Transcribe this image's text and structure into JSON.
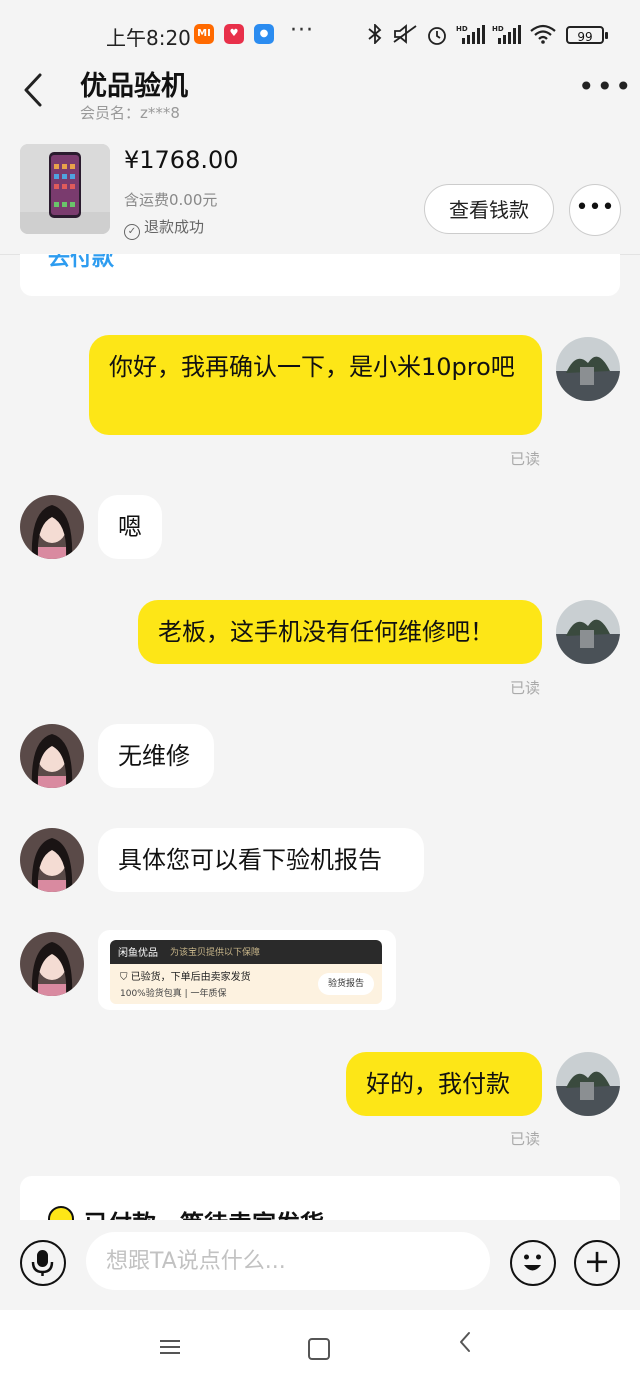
{
  "status_bar": {
    "time": "上午8:20",
    "battery": "99",
    "overflow": "···",
    "apps": [
      "mi-app-icon",
      "heart-app-icon",
      "chat-app-icon"
    ],
    "icons": [
      "bluetooth-icon",
      "mute-icon",
      "alarm-icon",
      "signal-hd-icon",
      "signal-hd-icon",
      "wifi-icon"
    ]
  },
  "header": {
    "title": "优品验机",
    "member_label": "会员名：z***8"
  },
  "product": {
    "price": "¥1768.00",
    "shipping": "含运费0.00元",
    "refund_status": "退款成功",
    "view_payment_button": "查看钱款"
  },
  "top_card": {
    "text": "去付款"
  },
  "messages": [
    {
      "side": "me",
      "text": "你好，我再确认一下，是小米10pro吧",
      "read": "已读"
    },
    {
      "side": "them",
      "text": "嗯"
    },
    {
      "side": "me",
      "text": "老板，这手机没有任何维修吧！",
      "read": "已读"
    },
    {
      "side": "them",
      "text": "无维修"
    },
    {
      "side": "them",
      "text": "具体您可以看下验机报告"
    },
    {
      "side": "them",
      "type": "report_card"
    },
    {
      "side": "me",
      "text": "好的，我付款",
      "read": "已读"
    }
  ],
  "report_card": {
    "brand": "闲鱼优品",
    "note": "为该宝贝提供以下保障",
    "line1": "已验货，下单后由卖家发货",
    "line2": "100%验货包真 | 一年质保",
    "button": "验货报告"
  },
  "bottom_card": {
    "text": "已付款，等待卖家发货"
  },
  "input_bar": {
    "placeholder": "想跟TA说点什么..."
  },
  "colors": {
    "accent_yellow": "#fde617",
    "link_blue": "#2d9cf0",
    "background": "#f4f4f4"
  }
}
